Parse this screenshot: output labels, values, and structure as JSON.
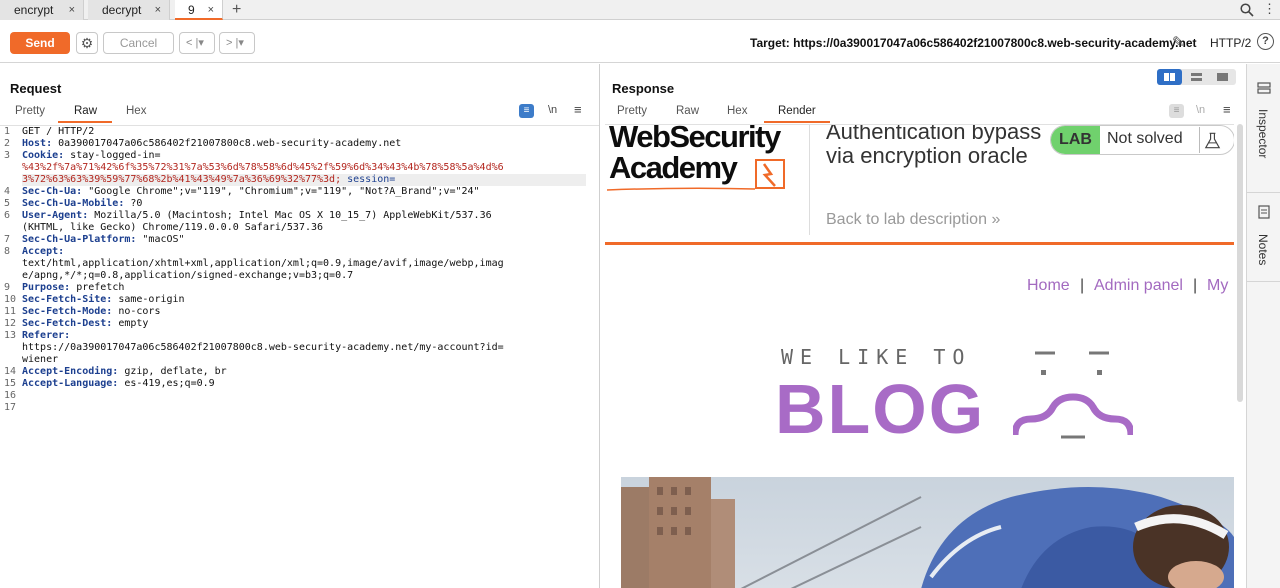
{
  "tabs": [
    {
      "label": "encrypt",
      "close": "×"
    },
    {
      "label": "decrypt",
      "close": "×"
    },
    {
      "label": "9",
      "close": "×"
    }
  ],
  "tabs_add": "+",
  "toolbar": {
    "send": "Send",
    "cancel": "Cancel",
    "back": "< |▾",
    "forward": "> |▾",
    "target": "Target: https://0a390017047a06c586402f21007800c8.web-security-academy.net",
    "protocol": "HTTP/2",
    "help": "?"
  },
  "request": {
    "title": "Request",
    "tabs": [
      "Pretty",
      "Raw",
      "Hex"
    ],
    "active_tab": "Raw",
    "newline_toggle": "\\n",
    "lines": [
      {
        "n": "1",
        "name": "",
        "value": "GET / HTTP/2"
      },
      {
        "n": "2",
        "name": "Host:",
        "value": " 0a390017047a06c586402f21007800c8.web-security-academy.net"
      },
      {
        "n": "3",
        "name": "Cookie:",
        "value": " stay-logged-in="
      },
      {
        "n": "",
        "cookie": "%43%2f%7a%71%42%6f%35%72%31%7a%53%6d%78%58%6d%45%2f%59%6d%34%43%4b%78%58%5a%4d%6"
      },
      {
        "n": "",
        "cookie": "3%72%63%63%39%59%77%68%2b%41%43%49%7a%36%69%32%77%3d;",
        "session": " session="
      },
      {
        "n": "4",
        "name": "Sec-Ch-Ua:",
        "value": " \"Google Chrome\";v=\"119\", \"Chromium\";v=\"119\", \"Not?A_Brand\";v=\"24\""
      },
      {
        "n": "5",
        "name": "Sec-Ch-Ua-Mobile:",
        "value": " ?0"
      },
      {
        "n": "6",
        "name": "User-Agent:",
        "value": " Mozilla/5.0 (Macintosh; Intel Mac OS X 10_15_7) AppleWebKit/537.36"
      },
      {
        "n": "",
        "name": "",
        "value": "(KHTML, like Gecko) Chrome/119.0.0.0 Safari/537.36"
      },
      {
        "n": "7",
        "name": "Sec-Ch-Ua-Platform:",
        "value": " \"macOS\""
      },
      {
        "n": "8",
        "name": "Accept:",
        "value": ""
      },
      {
        "n": "",
        "name": "",
        "value": "text/html,application/xhtml+xml,application/xml;q=0.9,image/avif,image/webp,imag"
      },
      {
        "n": "",
        "name": "",
        "value": "e/apng,*/*;q=0.8,application/signed-exchange;v=b3;q=0.7"
      },
      {
        "n": "9",
        "name": "Purpose:",
        "value": " prefetch"
      },
      {
        "n": "10",
        "name": "Sec-Fetch-Site:",
        "value": " same-origin"
      },
      {
        "n": "11",
        "name": "Sec-Fetch-Mode:",
        "value": " no-cors"
      },
      {
        "n": "12",
        "name": "Sec-Fetch-Dest:",
        "value": " empty"
      },
      {
        "n": "13",
        "name": "Referer:",
        "value": ""
      },
      {
        "n": "",
        "name": "",
        "value": "https://0a390017047a06c586402f21007800c8.web-security-academy.net/my-account?id="
      },
      {
        "n": "",
        "name": "",
        "value": "wiener"
      },
      {
        "n": "14",
        "name": "Accept-Encoding:",
        "value": " gzip, deflate, br"
      },
      {
        "n": "15",
        "name": "Accept-Language:",
        "value": " es-419,es;q=0.9"
      },
      {
        "n": "16",
        "name": "",
        "value": ""
      },
      {
        "n": "17",
        "name": "",
        "value": ""
      }
    ]
  },
  "response": {
    "title": "Response",
    "tabs": [
      "Pretty",
      "Raw",
      "Hex",
      "Render"
    ],
    "active_tab": "Render",
    "newline_toggle": "\\n"
  },
  "render": {
    "logo_line1": "WebSecurity",
    "logo_line2": "Academy",
    "lab_title": "Authentication bypass via encryption oracle",
    "back_link": "Back to lab description",
    "back_arrow": "»",
    "lab_badge": "LAB",
    "lab_status": "Not solved",
    "nav": [
      "Home",
      "Admin panel",
      "My"
    ],
    "nav_sep": "|",
    "blog_small": "WE LIKE TO",
    "blog_big": "BLOG"
  },
  "side_panel": {
    "inspector": "Inspector",
    "notes": "Notes"
  },
  "colors": {
    "accent": "#f06a29",
    "active_layout": "#2f6fc6",
    "lab_green": "#70d16d",
    "blog_purple": "#a86bc6"
  }
}
